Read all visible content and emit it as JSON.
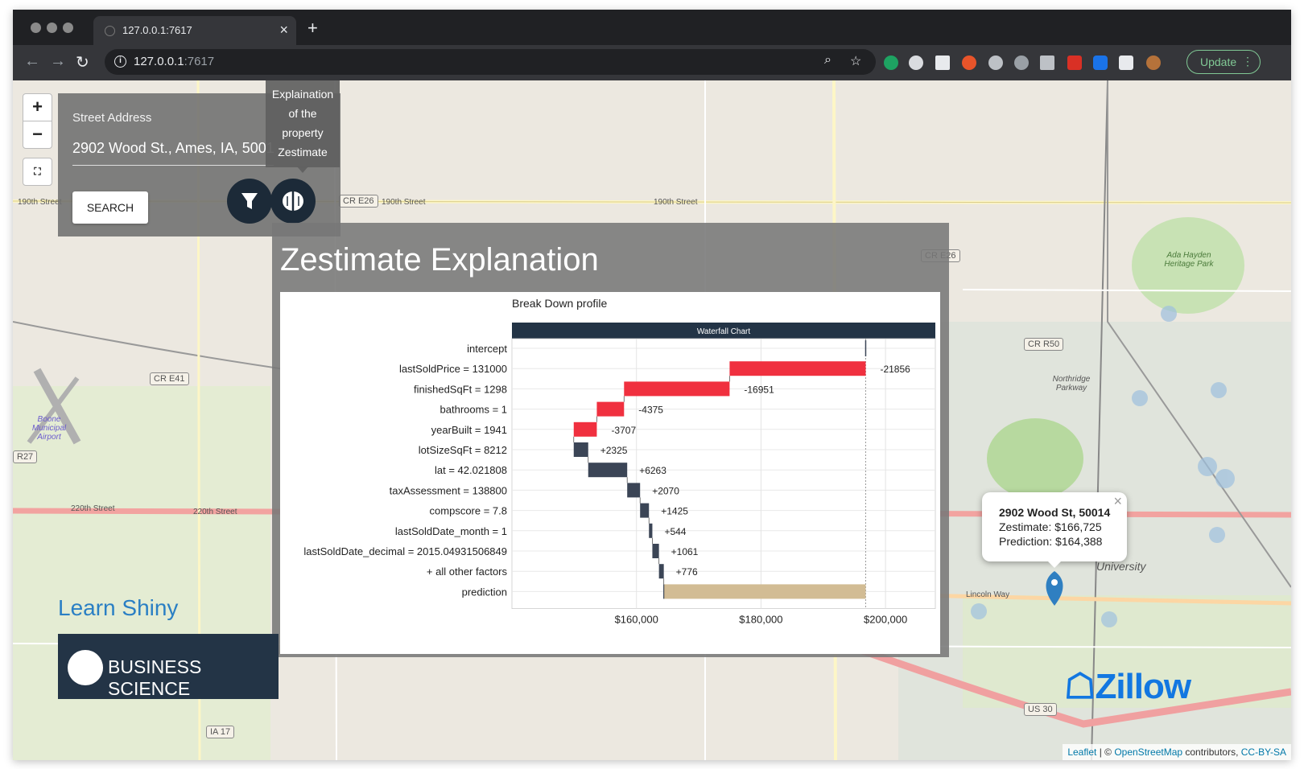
{
  "browser": {
    "tab_title": "127.0.0.1:7617",
    "url_host": "127.0.0.1",
    "url_port": ":7617",
    "update_label": "Update"
  },
  "search": {
    "label": "Street Address",
    "value": "2902 Wood St., Ames, IA, 50014",
    "button": "SEARCH"
  },
  "tooltip": {
    "lines": [
      "Explaination",
      "of the",
      "property",
      "Zestimate"
    ]
  },
  "zestimate_panel": {
    "title": "Zestimate Explanation"
  },
  "branding": {
    "learn": "Learn Shiny",
    "business": "BUSINESS SCIENCE",
    "zillow": "Zillow"
  },
  "popup": {
    "address": "2902 Wood St, 50014",
    "zestimate": "Zestimate: $166,725",
    "prediction": "Prediction: $164,388",
    "close": "×"
  },
  "attribution": {
    "leaflet": "Leaflet",
    "sep": " | © ",
    "osm": "OpenStreetMap",
    "contrib": " contributors, ",
    "license": "CC-BY-SA"
  },
  "map_labels": {
    "cr_e26": "CR E26",
    "cr_e41": "CR E41",
    "cr_r50": "CR R50",
    "us_30": "US 30",
    "ia_17": "IA 17",
    "r27": "R27",
    "street_190_a": "190th Street",
    "street_190_b": "190th Street",
    "street_190_c": "190th Street",
    "street_220": "220th Street",
    "street_220b": "220th Street",
    "airport": "Boone Municipal Airport",
    "ada": "Ada Hayden Heritage Park",
    "northridge": "Northridge Parkway",
    "lincoln": "Lincoln Way",
    "university": "University"
  },
  "chart_data": {
    "type": "waterfall",
    "title": "Break Down profile",
    "strip": "Waterfall Chart",
    "xlim": [
      140000,
      208000
    ],
    "x_ticks": [
      160000,
      180000,
      200000
    ],
    "x_tick_labels": [
      "$160,000",
      "$180,000",
      "$200,000"
    ],
    "intercept": 196813,
    "rows": [
      {
        "label": "intercept",
        "value": 196813,
        "text": "196813",
        "kind": "intercept"
      },
      {
        "label": "lastSoldPrice = 131000",
        "value": -21856,
        "text": "-21856",
        "kind": "neg"
      },
      {
        "label": "finishedSqFt = 1298",
        "value": -16951,
        "text": "-16951",
        "kind": "neg"
      },
      {
        "label": "bathrooms = 1",
        "value": -4375,
        "text": "-4375",
        "kind": "neg"
      },
      {
        "label": "yearBuilt = 1941",
        "value": -3707,
        "text": "-3707",
        "kind": "neg"
      },
      {
        "label": "lotSizeSqFt = 8212",
        "value": 2325,
        "text": "+2325",
        "kind": "pos"
      },
      {
        "label": "lat = 42.021808",
        "value": 6263,
        "text": "+6263",
        "kind": "pos"
      },
      {
        "label": "taxAssessment = 138800",
        "value": 2070,
        "text": "+2070",
        "kind": "pos"
      },
      {
        "label": "compscore = 7.8",
        "value": 1425,
        "text": "+1425",
        "kind": "pos"
      },
      {
        "label": "lastSoldDate_month = 1",
        "value": 544,
        "text": "+544",
        "kind": "pos"
      },
      {
        "label": "lastSoldDate_decimal = 2015.04931506849",
        "value": 1061,
        "text": "+1061",
        "kind": "pos"
      },
      {
        "label": "+ all other factors",
        "value": 776,
        "text": "+776",
        "kind": "pos"
      },
      {
        "label": "prediction",
        "value": 164388,
        "text": "164388",
        "kind": "prediction"
      }
    ],
    "colors": {
      "neg": "#f0303f",
      "pos": "#371f00",
      "pos_fill": "#3b4556",
      "prediction": "#d2bc94",
      "intercept": "#3b4556",
      "strip": "#233446"
    }
  }
}
